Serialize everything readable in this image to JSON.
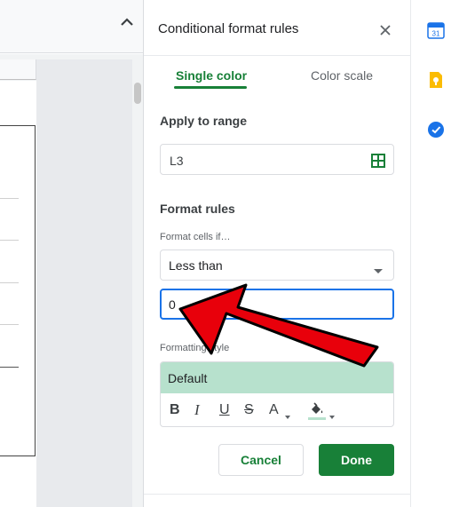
{
  "panel": {
    "title": "Conditional format rules",
    "tabs": [
      {
        "label": "Single color",
        "active": true
      },
      {
        "label": "Color scale",
        "active": false
      }
    ],
    "apply_to_range": {
      "label": "Apply to range",
      "value": "L3"
    },
    "format_rules": {
      "label": "Format rules",
      "condition_label": "Format cells if…",
      "condition_value": "Less than",
      "value": "0"
    },
    "formatting_style": {
      "label": "Formatting style",
      "preset": "Default",
      "toolbar": {
        "bold": "B",
        "italic": "I",
        "underline": "U",
        "strikethrough": "S",
        "text_color": "A"
      }
    },
    "buttons": {
      "cancel": "Cancel",
      "done": "Done"
    }
  },
  "colors": {
    "accent_green": "#188038",
    "preview_fill": "#b7e1cd",
    "focus_blue": "#1a73e8",
    "annotation_red": "#e8000b"
  },
  "icons": {
    "collapse": "chevron-up-icon",
    "close": "close-icon",
    "range_picker": "grid-icon",
    "dropdown": "dropdown-arrow-icon",
    "fill": "paint-bucket-icon",
    "sidebar": [
      "calendar-icon",
      "keep-icon",
      "tasks-icon"
    ]
  },
  "sidebar": {
    "calendar_day": "31"
  }
}
